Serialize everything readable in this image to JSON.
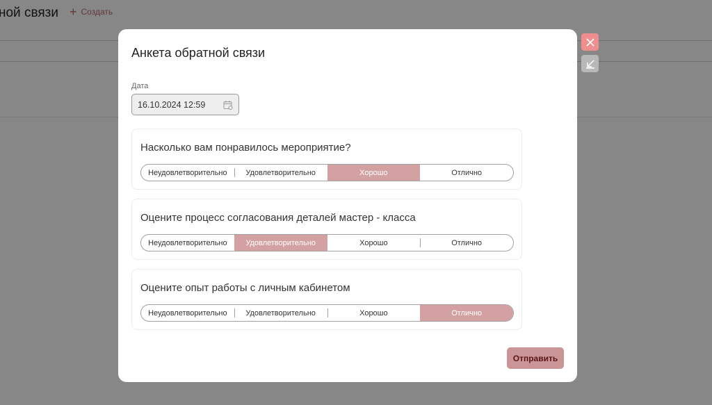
{
  "background": {
    "title": "ной связи",
    "create_label": "Создать"
  },
  "modal": {
    "title": "Анкета обратной связи",
    "date_label": "Дата",
    "date_value": "16.10.2024 12:59",
    "questions": [
      {
        "text": "Насколько вам понравилось мероприятие?",
        "options": [
          "Неудовлетворительно",
          "Удовлетворительно",
          "Хорошо",
          "Отлично"
        ],
        "selected": "Хорошо"
      },
      {
        "text": "Оцените процесс согласования деталей мастер - класса",
        "options": [
          "Неудовлетворительно",
          "Удовлетворительно",
          "Хорошо",
          "Отлично"
        ],
        "selected": "Удовлетворительно"
      },
      {
        "text": "Оцените опыт работы с личным кабинетом",
        "options": [
          "Неудовлетворительно",
          "Удовлетворительно",
          "Хорошо",
          "Отлично"
        ],
        "selected": "Отлично"
      }
    ],
    "submit_label": "Отправить"
  },
  "side_buttons": {
    "close_icon": "close-icon",
    "collapse_icon": "arrow-down-left-icon"
  },
  "colors": {
    "selected": "#d4a1a3",
    "close": "#ef8e8e",
    "submit_bg": "#c99596",
    "submit_text": "#5b1416"
  }
}
